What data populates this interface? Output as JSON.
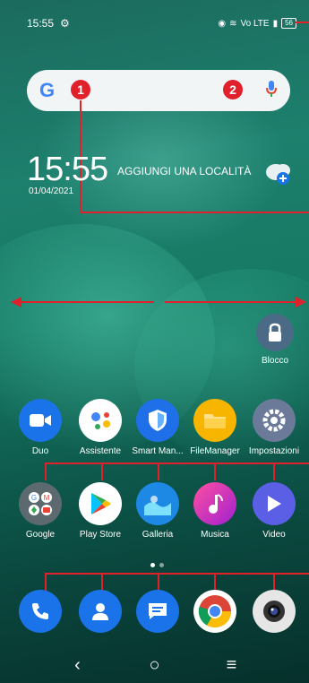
{
  "status": {
    "time": "15:55",
    "network": "Vo LTE",
    "battery": "56"
  },
  "search": {
    "logo": "G",
    "callout1": "1",
    "callout2": "2"
  },
  "widget": {
    "time": "15:55",
    "date": "01/04/2021",
    "location": "AGGIUNGI UNA LOCALITÀ"
  },
  "lock_app": {
    "label": "Blocco"
  },
  "apps_row1": [
    {
      "label": "Duo",
      "color": "#1a73e8",
      "icon": "video-camera-icon"
    },
    {
      "label": "Assistente",
      "color": "#ffffff",
      "icon": "assistant-icon"
    },
    {
      "label": "Smart Man...",
      "color": "#1f6fe8",
      "icon": "shield-icon"
    },
    {
      "label": "FileManager",
      "color": "#f7b500",
      "icon": "folder-icon"
    },
    {
      "label": "Impostazioni",
      "color": "#6c7a99",
      "icon": "settings-icon"
    }
  ],
  "apps_row2": [
    {
      "label": "Google",
      "color": "#5c6a70",
      "icon": "google-folder-icon"
    },
    {
      "label": "Play Store",
      "color": "#ffffff",
      "icon": "play-store-icon"
    },
    {
      "label": "Galleria",
      "color": "#1e88e5",
      "icon": "gallery-icon"
    },
    {
      "label": "Musica",
      "color": "#e91e63",
      "icon": "music-icon"
    },
    {
      "label": "Video",
      "color": "#5b5fe6",
      "icon": "video-play-icon"
    }
  ],
  "dock": [
    {
      "icon": "phone-icon",
      "color": "#1a73e8"
    },
    {
      "icon": "contacts-icon",
      "color": "#1a73e8"
    },
    {
      "icon": "messages-icon",
      "color": "#1a73e8"
    },
    {
      "icon": "chrome-icon",
      "color": "#ffffff"
    },
    {
      "icon": "camera-icon",
      "color": "#e6e6e6"
    }
  ],
  "nav": {
    "back": "‹",
    "home": "○",
    "recents": "≡"
  }
}
